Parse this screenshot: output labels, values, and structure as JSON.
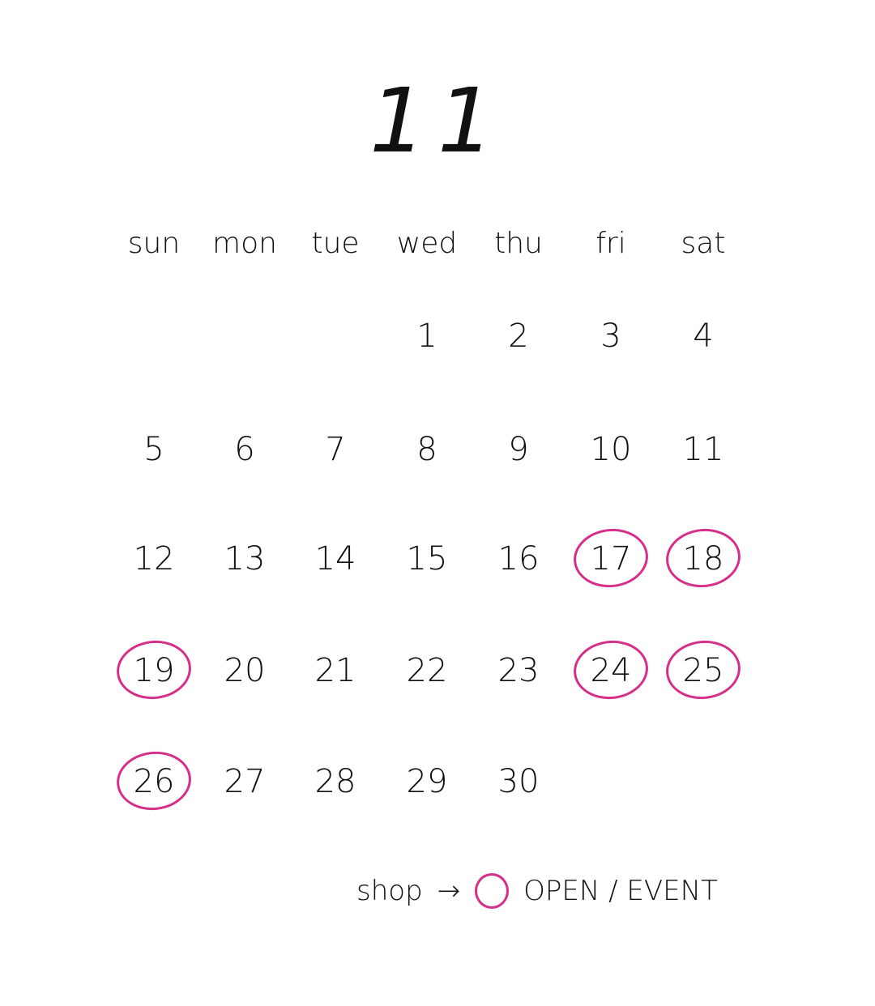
{
  "month": "11",
  "weekdays": [
    "sun",
    "mon",
    "tue",
    "wed",
    "thu",
    "fri",
    "sat"
  ],
  "weeks": [
    [
      "",
      "",
      "",
      "1",
      "2",
      "3",
      "4"
    ],
    [
      "5",
      "6",
      "7",
      "8",
      "9",
      "10",
      "11"
    ],
    [
      "12",
      "13",
      "14",
      "15",
      "16",
      "17",
      "18"
    ],
    [
      "19",
      "20",
      "21",
      "22",
      "23",
      "24",
      "25"
    ],
    [
      "26",
      "27",
      "28",
      "29",
      "30",
      "",
      ""
    ]
  ],
  "open_days": [
    "17",
    "18",
    "19",
    "24",
    "25",
    "26"
  ],
  "legend": {
    "shop": "shop",
    "arrow": "→",
    "label": "OPEN / EVENT",
    "circle_icon": "pink-circle-icon"
  },
  "colors": {
    "accent": "#d62f8a",
    "text": "#111111"
  }
}
